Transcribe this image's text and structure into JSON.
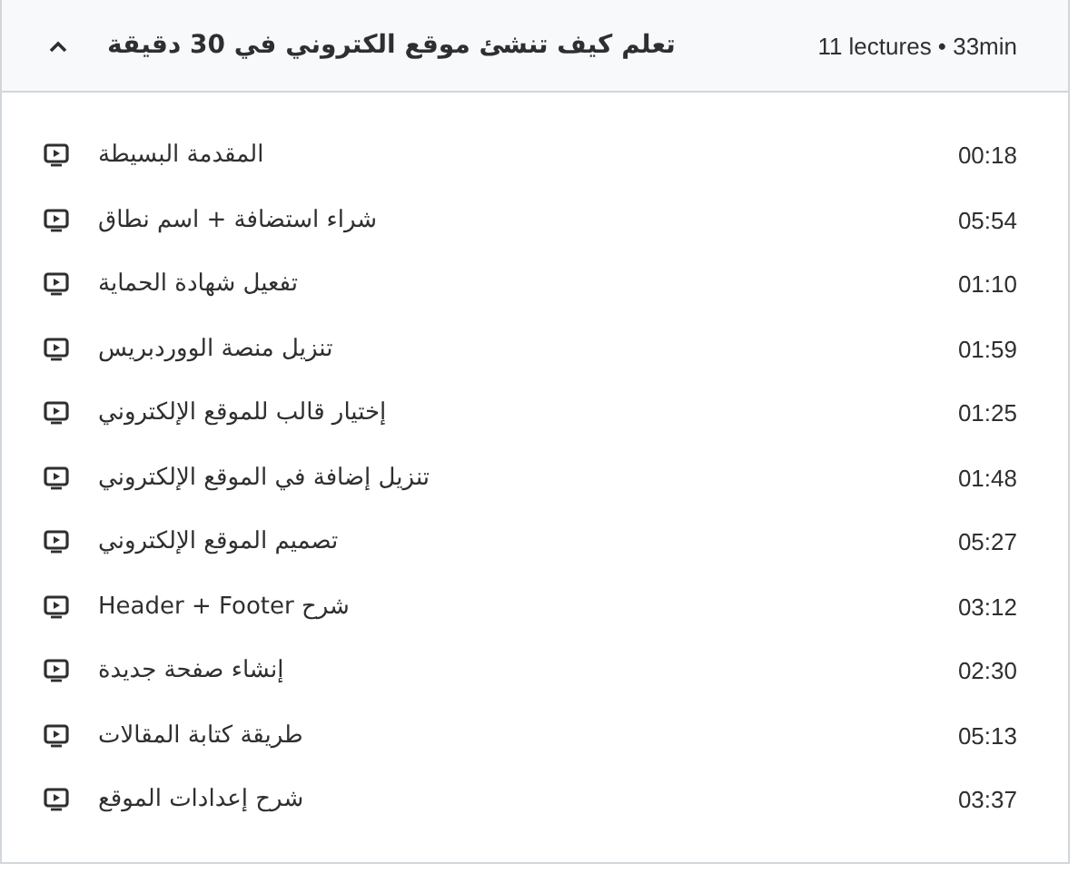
{
  "section": {
    "title": "تعلم كيف تنشئ موقع الكتروني في 30 دقيقة",
    "summary": "11 lectures • 33min",
    "expanded": true
  },
  "lectures": [
    {
      "title": "المقدمة البسيطة",
      "duration": "00:18"
    },
    {
      "title": "شراء استضافة + اسم نطاق",
      "duration": "05:54"
    },
    {
      "title": "تفعيل شهادة الحماية",
      "duration": "01:10"
    },
    {
      "title": "تنزيل منصة الووردبريس",
      "duration": "01:59"
    },
    {
      "title": "إختيار قالب للموقع الإلكتروني",
      "duration": "01:25"
    },
    {
      "title": "تنزيل إضافة في الموقع الإلكتروني",
      "duration": "01:48"
    },
    {
      "title": "تصميم الموقع الإلكتروني",
      "duration": "05:27"
    },
    {
      "title": "شرح Header + Footer",
      "duration": "03:12"
    },
    {
      "title": "إنشاء صفحة جديدة",
      "duration": "02:30"
    },
    {
      "title": "طريقة كتابة المقالات",
      "duration": "05:13"
    },
    {
      "title": "شرح إعدادات الموقع",
      "duration": "03:37"
    }
  ]
}
